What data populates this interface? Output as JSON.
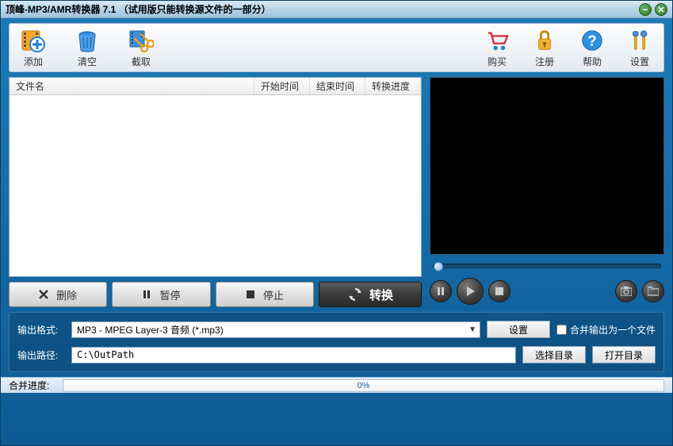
{
  "title": "顶峰-MP3/AMR转换器 7.1 （试用版只能转换源文件的一部分）",
  "toolbar": {
    "add": "添加",
    "clear": "清空",
    "cut": "截取",
    "buy": "购买",
    "register": "注册",
    "help": "帮助",
    "settings": "设置"
  },
  "list": {
    "col_name": "文件名",
    "col_start": "开始时间",
    "col_end": "结束时间",
    "col_progress": "转换进度"
  },
  "actions": {
    "delete": "删除",
    "pause": "暂停",
    "stop": "停止",
    "convert": "转换"
  },
  "settings": {
    "format_label": "输出格式:",
    "format_value": "MP3 - MPEG Layer-3 音频 (*.mp3)",
    "format_btn": "设置",
    "merge_label": "合并输出为一个文件",
    "path_label": "输出路径:",
    "path_value": "C:\\OutPath",
    "choose_dir": "选择目录",
    "open_dir": "打开目录"
  },
  "footer": {
    "progress_label": "合并进度:",
    "progress_text": "0%"
  }
}
